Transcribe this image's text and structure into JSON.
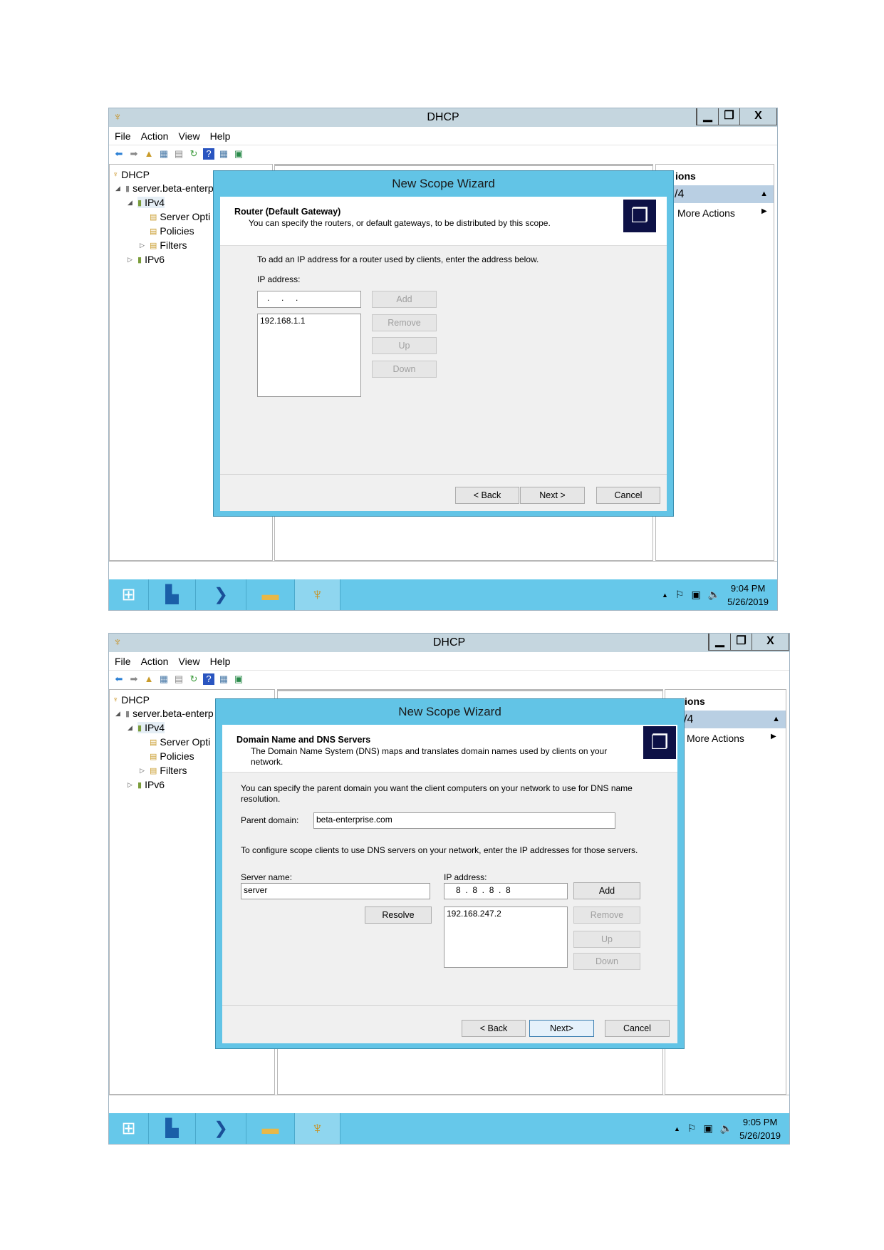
{
  "windows": [
    {
      "title": "DHCP",
      "menu": [
        "File",
        "Action",
        "View",
        "Help"
      ],
      "tree": [
        "DHCP",
        "server.beta-enterp",
        "IPv4",
        "Server Opti",
        "Policies",
        "Filters",
        "IPv6"
      ],
      "actions": {
        "header": "ions",
        "row": "/4",
        "more": "More Actions"
      },
      "clock": {
        "time": "9:04 PM",
        "date": "5/26/2019"
      },
      "dialog": {
        "title": "New Scope Wizard",
        "header_title": "Router (Default Gateway)",
        "header_sub": "You can specify the routers, or default gateways, to be distributed by this scope.",
        "instruction": "To add an IP address for a router used by clients, enter the address below.",
        "ip_label": "IP address:",
        "ip_value": "   .     .     .   ",
        "list": [
          "192.168.1.1"
        ],
        "buttons": {
          "add": "Add",
          "remove": "Remove",
          "up": "Up",
          "down": "Down",
          "back": "< Back",
          "next": "Next >",
          "cancel": "Cancel"
        }
      }
    },
    {
      "title": "DHCP",
      "menu": [
        "File",
        "Action",
        "View",
        "Help"
      ],
      "tree": [
        "DHCP",
        "server.beta-enterp",
        "IPv4",
        "Server Opti",
        "Policies",
        "Filters",
        "IPv6"
      ],
      "actions": {
        "header": "ions",
        "row": "/4",
        "more": "More Actions"
      },
      "clock": {
        "time": "9:05 PM",
        "date": "5/26/2019"
      },
      "dialog": {
        "title": "New Scope Wizard",
        "header_title": "Domain Name and DNS Servers",
        "header_sub": "The Domain Name System (DNS) maps and translates domain names used by clients on your network.",
        "instruction1": "You can specify the parent domain you want the client computers on your network to use for DNS name resolution.",
        "parent_domain_label": "Parent domain:",
        "parent_domain_value": "beta-enterprise.com",
        "instruction2": "To configure scope clients to use DNS servers on your network, enter the IP addresses for those servers.",
        "server_name_label": "Server name:",
        "server_name_value": "server",
        "ip_label": "IP address:",
        "ip_value": "8  .  8  .  8  .  8",
        "list": [
          "192.168.247.2"
        ],
        "buttons": {
          "add": "Add",
          "resolve": "Resolve",
          "remove": "Remove",
          "up": "Up",
          "down": "Down",
          "back": "< Back",
          "next": "Next>",
          "cancel": "Cancel"
        }
      }
    }
  ],
  "colors": {
    "taskbar": "#66c8ea",
    "dialog_frame": "#62c4e6",
    "titlebar": "#c5d6df"
  }
}
